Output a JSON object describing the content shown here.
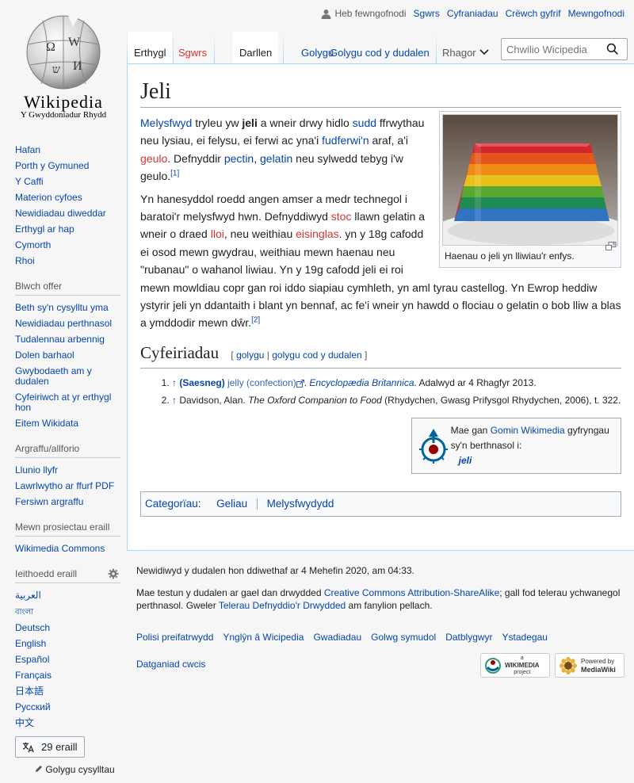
{
  "logo": {
    "wordmark": "Wikipedia",
    "tagline": "Y Gwyddoniadur Rhydd"
  },
  "personal": {
    "anon": "Heb fewngofnodi",
    "links": [
      "Sgwrs",
      "Cyfraniadau",
      "Crëwch gyfrif",
      "Mewngofnodi"
    ]
  },
  "tabs": {
    "article": "Erthygl",
    "talk": "Sgwrs",
    "read": "Darllen",
    "edit": "Golygu",
    "edit_source": "Golygu cod y dudalen",
    "more": "Rhagor"
  },
  "search": {
    "placeholder": "Chwilio Wicipedia"
  },
  "sidebar": {
    "nav": [
      "Hafan",
      "Porth y Gymuned",
      "Y Caffi",
      "Materion cyfoes",
      "Newidiadau diweddar",
      "Erthygl ar hap",
      "Cymorth",
      "Rhoi"
    ],
    "tools_heading": "Blwch offer",
    "tools": [
      "Beth sy'n cysylltu yma",
      "Newidiadau perthnasol",
      "Tudalennau arbennig",
      "Dolen barhaol",
      "Gwybodaeth am y dudalen",
      "Cyfeiriwch at yr erthygl hon",
      "Eitem Wikidata"
    ],
    "print_heading": "Argraffu/allforio",
    "print": [
      "Llunio llyfr",
      "Lawrlwytho ar ffurf PDF",
      "Fersiwn argraffu"
    ],
    "projects_heading": "Mewn prosiectau eraill",
    "projects": [
      "Wikimedia Commons"
    ],
    "lang_heading": "Ieithoedd eraill",
    "languages": [
      "العربية",
      "বাংলা",
      "Deutsch",
      "English",
      "Español",
      "Français",
      "日本語",
      "Русский",
      "中文"
    ],
    "lang_button": "29 eraill",
    "edit_links": "Golygu cysylltau"
  },
  "article": {
    "title": "Jeli",
    "p1": {
      "a": "Melysfwyd",
      "b": " tryleu yw ",
      "c": "jeli",
      "d": " a wneir drwy hidlo ",
      "e": "sudd",
      "f": " ffrwythau neu lysiau, ei felysu, ei ferwi ac yna'i ",
      "g": "fudferwi'n",
      "h": " araf, a'i ",
      "i": "geulo",
      "j": ". Defnyddir ",
      "k": "pectin",
      "l": ", ",
      "m": "gelatin",
      "n": " neu sylwedd tebyg i'w geulo.",
      "ref": "[1]"
    },
    "p2": {
      "a": "Yn hanesyddol roedd angen amser a medr technegol i baratoi'r melysfwyd hwn. Defnyddiwyd ",
      "b": "stoc",
      "c": " llawn gelatin a wneir o draed ",
      "d": "lloi",
      "e": ", neu weithiau ",
      "f": "eisinglas",
      "g": ". yn y 18g cafodd ei osod mewn gwydrau, weithiau mewn haenau neu \"rubanau\" o wahanol liwiau. Yn y 19g cafodd jeli ei roi mewn mowldiau copr gan roi iddo siapiau cymhleth, yn aml tyrau castellog. Yn Ewrop heddiw ystyrir jeli yn ddantaith i blant yn bennaf, ac fe'i wneir yn hawdd o flociau o gelatin o bob lliw a blas a ymddodir mewn dŵr.",
      "ref": "[2]"
    },
    "caption": "Haenau o jeli yn lliwiau'r enfys.",
    "refs_heading": "Cyfeiriadau",
    "edit_section": {
      "open": "[",
      "edit": "golygu",
      "sep": "|",
      "edit_source": "golygu cod y dudalen",
      "close": "]"
    },
    "ref1": {
      "arrow": "↑",
      "lang": "(Saesneg)",
      "link": "jelly (confection)",
      "dot": ". ",
      "work": "Encyclopædia Britannica",
      "rest": ". Adalwyd ar 4 Rhagfyr 2013."
    },
    "ref2": {
      "arrow": "↑",
      "author": "Davidson, Alan. ",
      "work": "The Oxford Companion to Food",
      "rest": " (Rhydychen, Gwasg Prifysgol Rhydychen, 2006), t. 322."
    },
    "commons": {
      "pre": "Mae gan ",
      "link": "Gomin Wikimedia",
      "post": " gyfryngau sy'n berthnasol i:",
      "item": "jeli"
    },
    "categories": {
      "label": "Categorïau",
      "colon": ":",
      "items": [
        "Geliau",
        "Melysfwydydd"
      ]
    }
  },
  "footer": {
    "lastmod": "Newidiwyd y dudalen hon ddiwethaf ar 4 Mehefin 2020, am 04:33.",
    "license_pre": "Mae testun y dudalen ar gael dan drwydded ",
    "license_link": "Creative Commons Attribution-ShareAlike",
    "license_mid": "; gall fod telerau ychwanegol perthnasol. Gweler ",
    "terms_link": "Telerau Defnyddio'r Drwydded",
    "license_post": " am fanylion pellach.",
    "places": [
      "Polisi preifatrwydd",
      "Ynglŷn â Wicipedia",
      "Gwadiadau",
      "Golwg symudol",
      "Datblygwyr",
      "Ystadegau"
    ],
    "cookie": "Datganiad cwcis",
    "badge1_small": "a",
    "badge1_big": "WIKIMEDIA",
    "badge1_sub": "project",
    "badge2_small": "Powered by",
    "badge2_big": "MediaWiki"
  }
}
